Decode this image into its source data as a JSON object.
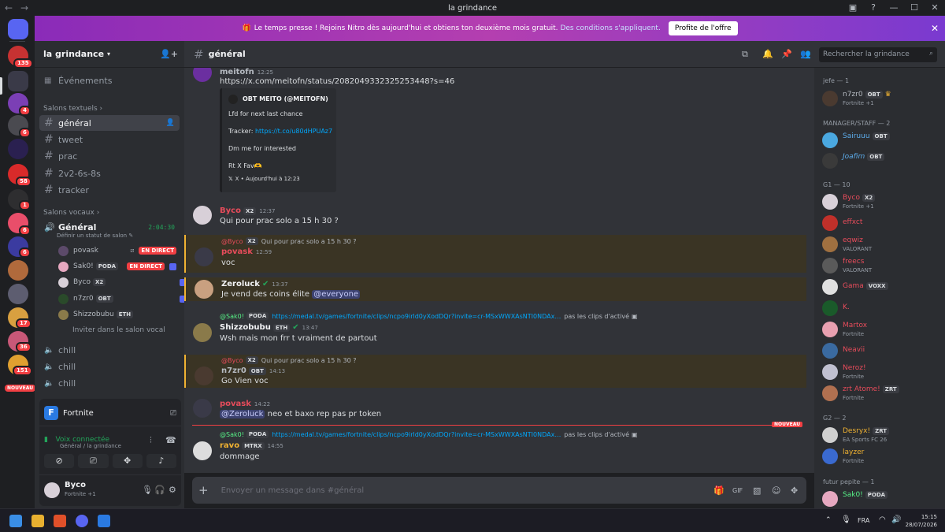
{
  "window": {
    "title": "la grindance",
    "back": "←",
    "forward": "→"
  },
  "banner": {
    "text": "Le temps presse ! Rejoins Nitro dès aujourd'hui et obtiens ton deuxième mois gratuit.",
    "link": "Des conditions s'appliquent.",
    "button": "Profite de l'offre",
    "close": "✕"
  },
  "rail": {
    "badges": [
      "135",
      "4",
      "6",
      "58",
      "1",
      "6",
      "6",
      "17",
      "36",
      "151"
    ],
    "new_label": "NOUVEAU"
  },
  "server": {
    "name": "la grindance",
    "events": "Événements"
  },
  "channels": {
    "text_category": "Salons textuels",
    "text": [
      "général",
      "tweet",
      "prac",
      "2v2-6s-8s",
      "tracker"
    ],
    "voice_category": "Salons vocaux",
    "voice_main": "Général",
    "voice_timer": "2:04:30",
    "voice_status": "Définir un statut de salon",
    "voice_users": [
      {
        "name": "povask",
        "tag": "",
        "live": "EN DIRECT"
      },
      {
        "name": "Sak0!",
        "tag": "PODA",
        "live": "EN DIRECT"
      },
      {
        "name": "Byco",
        "tag": "X2",
        "live": ""
      },
      {
        "name": "n7zr0",
        "tag": "OBT",
        "live": ""
      },
      {
        "name": "Shizzobubu",
        "tag": "ETH",
        "live": ""
      }
    ],
    "invite": "Inviter dans le salon vocal",
    "other_voice": [
      "chill",
      "chill",
      "chill"
    ]
  },
  "activity": {
    "game": "Fortnite"
  },
  "voice_panel": {
    "status": "Voix connectée",
    "location": "Général / la grindance"
  },
  "user": {
    "name": "Byco",
    "status": "Fortnite +1"
  },
  "chat": {
    "channel": "général",
    "search_placeholder": "Rechercher la grindance",
    "input_placeholder": "Envoyer un message dans #général",
    "new_label": "NOUVEAU"
  },
  "messages": {
    "m1": {
      "author": "meitofn",
      "time": "12:25",
      "link": "https://x.com/meitofn/status/2082049332325253448?s=46",
      "embed": {
        "author": "OBT MEITO (@MEITOFN)",
        "line1": "Lfd for next last chance",
        "tracker_label": "Tracker:",
        "tracker_link": "https://t.co/u80dHPUAz7",
        "line3": "Dm me for interested",
        "line4": "Rt X Fav🫶",
        "footer": "X • Aujourd'hui à 12:23"
      }
    },
    "m2": {
      "author": "Byco",
      "tag": "X2",
      "time": "12:37",
      "text": "Qui pour prac solo a 15 h 30 ?"
    },
    "m3": {
      "reply_author": "@Byco",
      "reply_tag": "X2",
      "reply_text": "Qui pour prac solo a 15 h 30 ?",
      "author": "povask",
      "time": "12:59",
      "text": "voc"
    },
    "m4": {
      "author": "Zeroluck",
      "time": "13:37",
      "text": "Je vend des coins élite",
      "mention": "@everyone"
    },
    "m5": {
      "reply_author": "@Sak0!",
      "reply_tag": "PODA",
      "reply_link": "https://medal.tv/games/fortnite/clips/ncpo9irld0yXodDQr?invite=cr-MSxWWXAsNTI0NDAxNDUz",
      "reply_suffix": "pas les clips d'activé",
      "author": "Shizzobubu",
      "tag": "ETH",
      "time": "13:47",
      "text": "Wsh mais mon frr t vraiment de partout"
    },
    "m6": {
      "reply_author": "@Byco",
      "reply_tag": "X2",
      "reply_text": "Qui pour prac solo a 15 h 30 ?",
      "author": "n7zr0",
      "tag": "OBT",
      "time": "14:13",
      "text": "Go Vien voc"
    },
    "m7": {
      "author": "povask",
      "time": "14:22",
      "mention": "@Zeroluck",
      "text": "neo et baxo  rep pas pr token"
    },
    "m8": {
      "reply_author": "@Sak0!",
      "reply_tag": "PODA",
      "reply_link": "https://medal.tv/games/fortnite/clips/ncpo9irld0yXodDQr?invite=cr-MSxWWXAsNTI0NDAxNDUz",
      "reply_suffix": "pas les clips d'activé",
      "author": "ravo",
      "tag": "MTRX",
      "time": "14:55",
      "text": "dommage"
    }
  },
  "members": {
    "cat1": "jefe — 1",
    "cat2": "MANAGER/STAFF — 2",
    "cat3": "G1 — 10",
    "cat4": "G2 — 2",
    "cat5": "futur pepite — 1",
    "list": [
      {
        "name": "n7zr0",
        "tag": "OBT",
        "status": "Fortnite +1",
        "color": "#b5bac1"
      },
      {
        "name": "Sairuuu",
        "tag": "OBT",
        "status": "",
        "color": "#5dadec"
      },
      {
        "name": "Joafim",
        "tag": "OBT",
        "status": "",
        "color": "#5dadec"
      },
      {
        "name": "Byco",
        "tag": "X2",
        "status": "Fortnite +1",
        "color": "#e74c5b"
      },
      {
        "name": "effxct",
        "tag": "",
        "status": "",
        "color": "#e74c5b"
      },
      {
        "name": "eqwiz",
        "tag": "",
        "status": "VALORANT",
        "color": "#e74c5b"
      },
      {
        "name": "freecs",
        "tag": "",
        "status": "VALORANT",
        "color": "#e74c5b"
      },
      {
        "name": "Gama",
        "tag": "VOXX",
        "status": "",
        "color": "#e74c5b"
      },
      {
        "name": "K.",
        "tag": "",
        "status": "",
        "color": "#e74c5b"
      },
      {
        "name": "Martox",
        "tag": "",
        "status": "Fortnite",
        "color": "#e74c5b"
      },
      {
        "name": "Neavii",
        "tag": "",
        "status": "",
        "color": "#e74c5b"
      },
      {
        "name": "Neroz!",
        "tag": "",
        "status": "Fortnite",
        "color": "#e74c5b"
      },
      {
        "name": "zrt Atome!",
        "tag": "ZRT",
        "status": "Fortnite",
        "color": "#e74c5b"
      },
      {
        "name": "Desryx!",
        "tag": "ZRT",
        "status": "EA Sports FC 26",
        "color": "#f0b232"
      },
      {
        "name": "layzer",
        "tag": "",
        "status": "Fortnite",
        "color": "#f0b232"
      },
      {
        "name": "Sak0!",
        "tag": "PODA",
        "status": "",
        "color": "#57f287"
      }
    ]
  },
  "taskbar": {
    "lang": "FRA",
    "time": "15:15",
    "date": "28/07/2026"
  },
  "colors": {
    "accent": "#5865f2",
    "online": "#23a55a",
    "live": "#f23f43",
    "mention_bg": "#3c4270"
  }
}
